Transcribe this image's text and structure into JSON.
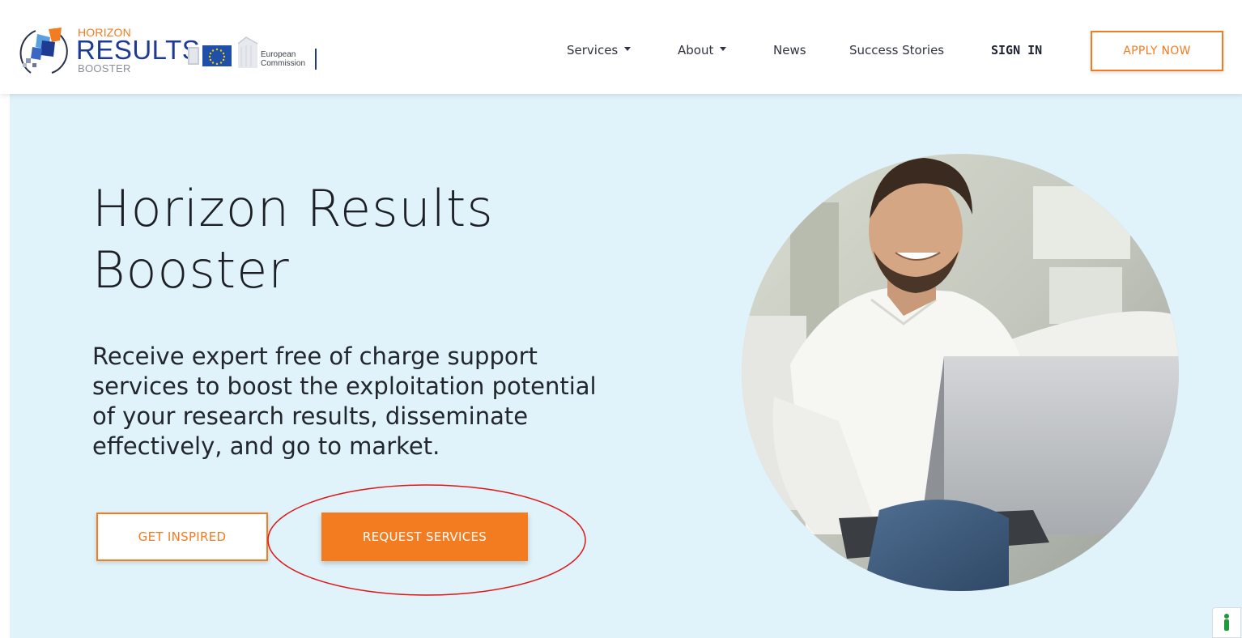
{
  "brand": {
    "logo_top": "HORIZON",
    "logo_main": "RESULTS",
    "logo_bottom": "BOOSTER",
    "ec_line1": "European",
    "ec_line2": "Commission"
  },
  "nav": {
    "services": "Services",
    "about": "About",
    "news": "News",
    "success_stories": "Success Stories",
    "sign_in": "SIGN IN",
    "apply_now": "APPLY NOW"
  },
  "hero": {
    "title_line1": "Horizon Results",
    "title_line2": "Booster",
    "subtitle_line1": "Receive expert free of charge support",
    "subtitle_line2": "services to boost the exploitation potential",
    "subtitle_line3": "of your research results, disseminate",
    "subtitle_line4": "effectively, and go to market.",
    "btn_inspired": "GET INSPIRED",
    "btn_request": "REQUEST SERVICES"
  },
  "icons": {
    "accessibility": "accessibility-icon",
    "dropdown": "chevron-down-icon"
  },
  "colors": {
    "accent": "#f47c20",
    "brand_blue": "#1f3a93",
    "hero_bg": "#e0f2fa",
    "annotation": "#e01515"
  }
}
